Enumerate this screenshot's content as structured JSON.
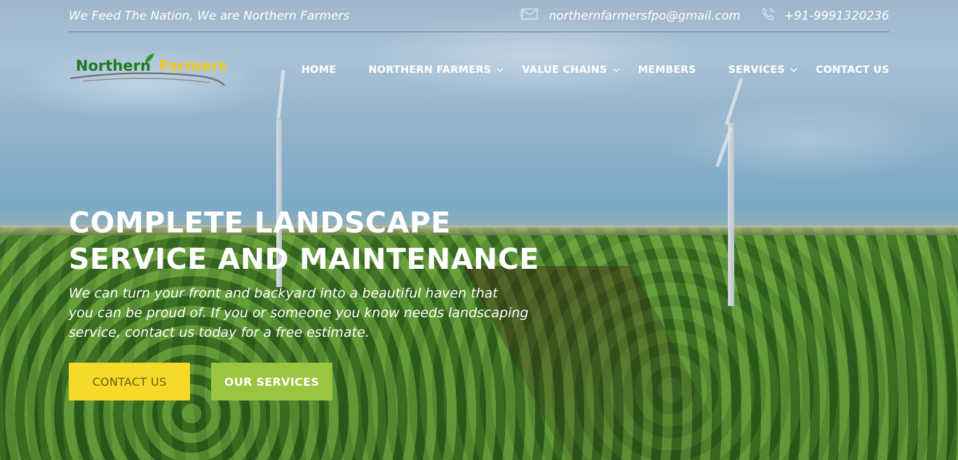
{
  "topbar": {
    "tagline": "We Feed The Nation, We are Northern Farmers",
    "email": "northernfarmersfpo@gmail.com",
    "phone": "+91-9991320236",
    "email_icon": "mail-icon",
    "phone_icon": "phone-icon"
  },
  "logo": {
    "word1": "Northern",
    "word2": "Farmers"
  },
  "nav": {
    "items": [
      {
        "label": "HOME",
        "has_dropdown": false
      },
      {
        "label": "NORTHERN FARMERS",
        "has_dropdown": true
      },
      {
        "label": "VALUE CHAINS",
        "has_dropdown": true
      },
      {
        "label": "MEMBERS",
        "has_dropdown": false
      },
      {
        "label": "SERVICES",
        "has_dropdown": true
      },
      {
        "label": "CONTACT US",
        "has_dropdown": false
      }
    ]
  },
  "hero": {
    "headline_line1": "COMPLETE LANDSCAPE",
    "headline_line2": "SERVICE AND MAINTENANCE",
    "subtext_line1": "We can turn your front and backyard into a beautiful haven that",
    "subtext_line2": "you can be proud of. If you or someone you know needs landscaping",
    "subtext_line3": "service, contact us today for a free estimate.",
    "primary_button": "CONTACT US",
    "secondary_button": "OUR SERVICES"
  },
  "colors": {
    "logo_green": "#1f7a1f",
    "logo_yellow": "#f2c81c",
    "contact_button": "#f5da2a",
    "services_button": "#9ac53e"
  }
}
